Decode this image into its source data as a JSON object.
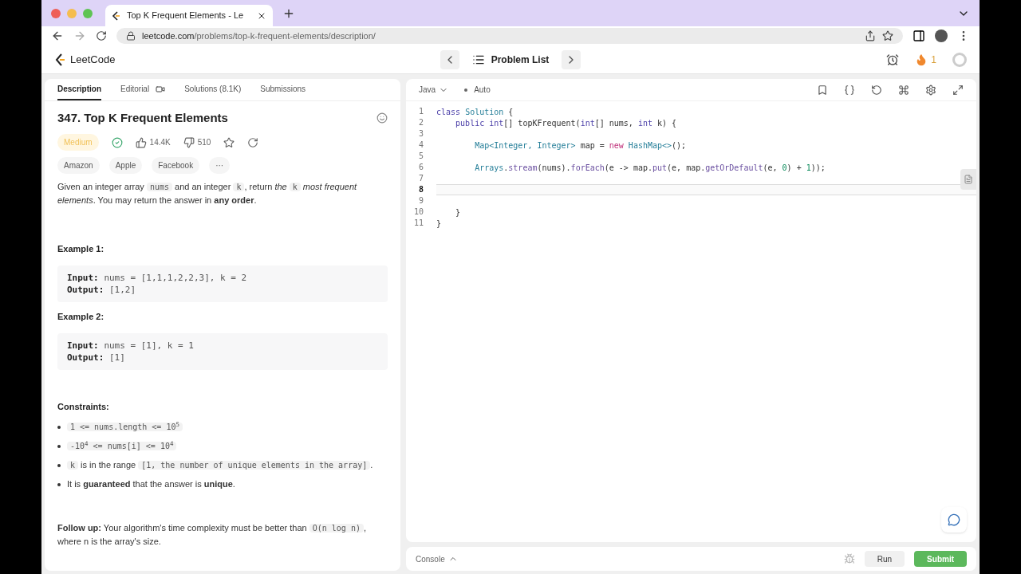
{
  "browser": {
    "tab_title": "Top K Frequent Elements - Le",
    "url_host": "leetcode.com",
    "url_path": "/problems/top-k-frequent-elements/description/"
  },
  "header": {
    "logo": "LeetCode",
    "problem_list": "Problem List",
    "streak": "1"
  },
  "left_tabs": [
    {
      "label": "Description",
      "selected": true
    },
    {
      "label": "Editorial",
      "selected": false
    },
    {
      "label": "Solutions (8.1K)",
      "selected": false
    },
    {
      "label": "Submissions",
      "selected": false
    }
  ],
  "problem": {
    "title": "347. Top K Frequent Elements",
    "difficulty": "Medium",
    "likes": "14.4K",
    "dislikes": "510",
    "companies": [
      "Amazon",
      "Apple",
      "Facebook"
    ],
    "more": "···",
    "statement": [
      {
        "kind": "text",
        "text": "Given an integer array "
      },
      {
        "kind": "code",
        "text": "nums"
      },
      {
        "kind": "text",
        "text": " and an integer "
      },
      {
        "kind": "code",
        "text": "k"
      },
      {
        "kind": "text",
        "text": ", return "
      },
      {
        "kind": "italic",
        "text": "the "
      },
      {
        "kind": "code",
        "text": "k"
      },
      {
        "kind": "italic",
        "text": " most frequent elements"
      },
      {
        "kind": "text",
        "text": ". You may return the answer in "
      },
      {
        "kind": "bold",
        "text": "any order"
      },
      {
        "kind": "text",
        "text": "."
      }
    ],
    "examples": [
      {
        "heading": "Example 1:",
        "input_label": "Input:",
        "input": "nums = [1,1,1,2,2,3], k = 2",
        "output_label": "Output:",
        "output": "[1,2]"
      },
      {
        "heading": "Example 2:",
        "input_label": "Input:",
        "input": "nums = [1], k = 1",
        "output_label": "Output:",
        "output": "[1]"
      }
    ],
    "constraints_heading": "Constraints:",
    "constraints": [
      [
        {
          "kind": "code",
          "text": "1 <= nums.length <= 10$^{5}$"
        }
      ],
      [
        {
          "kind": "code",
          "text": "-10$^{4}$ <= nums[i] <= 10$^{4}$"
        }
      ],
      [
        {
          "kind": "code",
          "text": "k"
        },
        {
          "kind": "text",
          "text": " is in the range "
        },
        {
          "kind": "code",
          "text": "[1, the number of unique elements in the array]"
        },
        {
          "kind": "text",
          "text": "."
        }
      ],
      [
        {
          "kind": "text",
          "text": "It is "
        },
        {
          "kind": "bold",
          "text": "guaranteed"
        },
        {
          "kind": "text",
          "text": " that the answer is "
        },
        {
          "kind": "bold",
          "text": "unique"
        },
        {
          "kind": "text",
          "text": "."
        }
      ]
    ],
    "follow_up": [
      {
        "kind": "bold",
        "text": "Follow up:"
      },
      {
        "kind": "text",
        "text": " Your algorithm's time complexity must be better than "
      },
      {
        "kind": "code",
        "text": "O(n log n)"
      },
      {
        "kind": "text",
        "text": ", where n is the array's size."
      }
    ]
  },
  "editor": {
    "language": "Java",
    "mode": "Auto",
    "lines": [
      {
        "number": "1",
        "active": false,
        "tokens": [
          {
            "kind": "keyword",
            "text": "class "
          },
          {
            "kind": "type",
            "text": "Solution"
          },
          {
            "kind": "plain",
            "text": " {"
          }
        ]
      },
      {
        "number": "2",
        "active": false,
        "tokens": [
          {
            "kind": "keyword",
            "text": "    public int"
          },
          {
            "kind": "plain",
            "text": "[] topKFrequent("
          },
          {
            "kind": "keyword",
            "text": "int"
          },
          {
            "kind": "plain",
            "text": "[] nums, "
          },
          {
            "kind": "keyword",
            "text": "int"
          },
          {
            "kind": "plain",
            "text": " k) {"
          }
        ]
      },
      {
        "number": "3",
        "active": false
      },
      {
        "number": "4",
        "active": false,
        "tokens": [
          {
            "kind": "type",
            "text": "        Map<Integer, Integer>"
          },
          {
            "kind": "plain",
            "text": " map = "
          },
          {
            "kind": "new",
            "text": "new "
          },
          {
            "kind": "type",
            "text": "HashMap<>"
          },
          {
            "kind": "plain",
            "text": "();"
          }
        ]
      },
      {
        "number": "5",
        "active": false
      },
      {
        "number": "6",
        "active": false,
        "tokens": [
          {
            "kind": "type",
            "text": "        Arrays"
          },
          {
            "kind": "plain",
            "text": "."
          },
          {
            "kind": "method",
            "text": "stream"
          },
          {
            "kind": "plain",
            "text": "(nums)."
          },
          {
            "kind": "method",
            "text": "forEach"
          },
          {
            "kind": "plain",
            "text": "(e -> map."
          },
          {
            "kind": "method",
            "text": "put"
          },
          {
            "kind": "plain",
            "text": "(e, map."
          },
          {
            "kind": "method",
            "text": "getOrDefault"
          },
          {
            "kind": "plain",
            "text": "(e, "
          },
          {
            "kind": "number",
            "text": "0"
          },
          {
            "kind": "plain",
            "text": ") + "
          },
          {
            "kind": "number",
            "text": "1"
          },
          {
            "kind": "plain",
            "text": "));"
          }
        ]
      },
      {
        "number": "7",
        "active": false
      },
      {
        "number": "8",
        "active": true
      },
      {
        "number": "9",
        "active": false
      },
      {
        "number": "10",
        "active": false,
        "tokens": [
          {
            "kind": "plain",
            "text": "    }"
          }
        ]
      },
      {
        "number": "11",
        "active": false,
        "tokens": [
          {
            "kind": "plain",
            "text": "}"
          }
        ]
      }
    ]
  },
  "footer": {
    "console": "Console",
    "run": "Run",
    "submit": "Submit"
  }
}
